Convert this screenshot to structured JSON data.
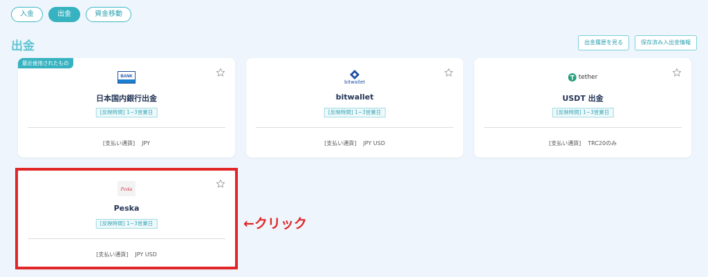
{
  "tabs": [
    {
      "label": "入金",
      "active": false
    },
    {
      "label": "出金",
      "active": true
    },
    {
      "label": "資金移動",
      "active": false
    }
  ],
  "page": {
    "title": "出金"
  },
  "header_actions": {
    "history_button": "出金履歴を見る",
    "saved_info_button": "保存済み入出金情報"
  },
  "recent_badge": "最近使用されたもの",
  "currency_label": "[支払い通貨]",
  "cards": [
    {
      "title": "日本国内銀行出金",
      "time": "[反映時間] 1~3営業日",
      "currency": "JPY",
      "logo": "bank-icon",
      "logo_text": "BANK"
    },
    {
      "title": "bitwallet",
      "time": "[反映時間] 1~3営業日",
      "currency": "JPY USD",
      "logo": "bitwallet-icon",
      "logo_text": "bitwallet"
    },
    {
      "title": "USDT 出金",
      "time": "[反映時間] 1~3営業日",
      "currency": "TRC20のみ",
      "logo": "tether-icon",
      "logo_text": "tether"
    },
    {
      "title": "Peska",
      "time": "[反映時間] 1~3営業日",
      "currency": "JPY USD",
      "logo": "peska-icon",
      "logo_text": "Peska"
    }
  ],
  "annotation": "←クリック",
  "colors": {
    "accent": "#36b2c0",
    "highlight": "#e02626",
    "title": "#223355"
  }
}
